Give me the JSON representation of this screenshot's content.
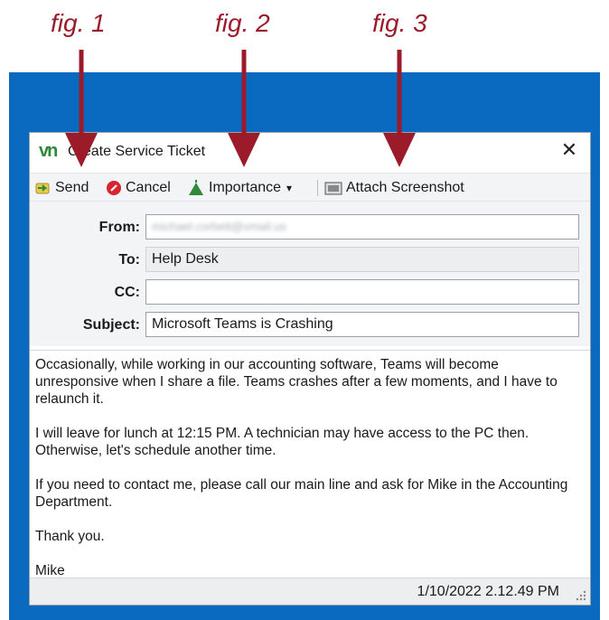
{
  "figures": [
    "fig. 1",
    "fig. 2",
    "fig. 3"
  ],
  "window": {
    "title": "Create Service Ticket",
    "logo": "vn",
    "close_glyph": "✕"
  },
  "toolbar": {
    "send_label": "Send",
    "cancel_label": "Cancel",
    "importance_label": "Importance",
    "importance_dropdown_glyph": "▾",
    "attach_label": "Attach Screenshot"
  },
  "form": {
    "from_label": "From:",
    "from_value": "michael.corbett@vmail.us",
    "to_label": "To:",
    "to_value": "Help Desk",
    "cc_label": "CC:",
    "cc_value": "",
    "subject_label": "Subject:",
    "subject_value": "Microsoft Teams is Crashing"
  },
  "message": {
    "p1": "Occasionally, while working in our accounting software, Teams will become unresponsive when I share a file. Teams crashes after a few moments, and I have to relaunch it.",
    "p2": "I will leave for lunch at 12:15 PM. A technician may have access to the PC then. Otherwise, let's schedule another time.",
    "p3": "If you need to contact me, please call our main line and ask for Mike in the Accounting Department.",
    "p4": "Thank you.",
    "p5": "Mike"
  },
  "status": {
    "timestamp": "1/10/2022 2.12.49 PM"
  },
  "colors": {
    "annotation": "#9b1b2a",
    "desktop": "#0a6abf"
  },
  "icons": [
    "send-icon",
    "cancel-icon",
    "importance-flag-icon",
    "attach-screenshot-icon",
    "close-icon",
    "resize-grip-icon"
  ]
}
